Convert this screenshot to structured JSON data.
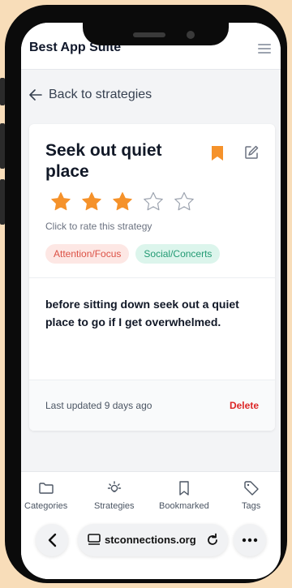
{
  "app": {
    "title": "Best App Suite"
  },
  "nav": {
    "back_label": "Back to strategies"
  },
  "strategy": {
    "title": "Seek out quiet place",
    "rating": 3,
    "max_rating": 5,
    "rate_hint": "Click to rate this strategy",
    "tags": [
      {
        "label": "Attention/Focus"
      },
      {
        "label": "Social/Concerts"
      }
    ],
    "description": "before sitting down seek out a quiet place to go if I get overwhelmed.",
    "last_updated": "Last updated 9 days ago",
    "delete_label": "Delete"
  },
  "tabs": [
    {
      "label": "Categories",
      "icon": "folder-icon"
    },
    {
      "label": "Strategies",
      "icon": "lightbulb-icon"
    },
    {
      "label": "Bookmarked",
      "icon": "bookmark-icon"
    },
    {
      "label": "Tags",
      "icon": "tag-icon"
    }
  ],
  "browser": {
    "url": "stconnections.org"
  },
  "colors": {
    "accent": "#f5922b",
    "danger": "#dc2626",
    "tag_attention_bg": "#fde7e4",
    "tag_social_bg": "#dcf5ec"
  }
}
